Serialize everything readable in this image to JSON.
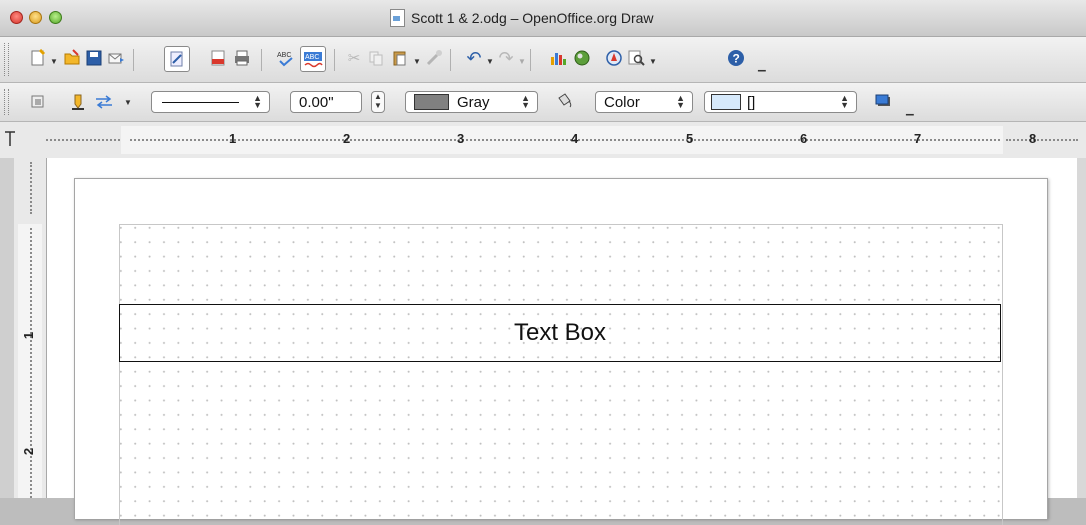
{
  "window": {
    "title": "Scott 1 & 2.odg – OpenOffice.org Draw"
  },
  "toolbar_standard": {
    "icons": [
      "new-icon",
      "open-icon",
      "save-icon",
      "email-icon",
      "edit-file-icon",
      "export-pdf-icon",
      "print-icon",
      "spellcheck-icon",
      "autospellcheck-icon",
      "cut-icon",
      "copy-icon",
      "paste-icon",
      "clone-format-icon",
      "undo-icon",
      "redo-icon",
      "chart-icon",
      "gallery-icon",
      "navigator-icon",
      "zoom-icon",
      "help-icon"
    ]
  },
  "toolbar_line_fill": {
    "line_style_value": "",
    "line_width_value": "0.00\"",
    "line_color_value": "Gray",
    "line_color_swatch": "#808080",
    "area_style_value": "Color",
    "area_fill_value": "[]",
    "area_fill_swatch": "#d6e9fb"
  },
  "ruler": {
    "h_labels": [
      "1",
      "2",
      "3",
      "4",
      "5",
      "6",
      "7",
      "8"
    ],
    "v_labels": [
      "1",
      "2"
    ]
  },
  "document": {
    "textbox_text": "Text Box"
  }
}
